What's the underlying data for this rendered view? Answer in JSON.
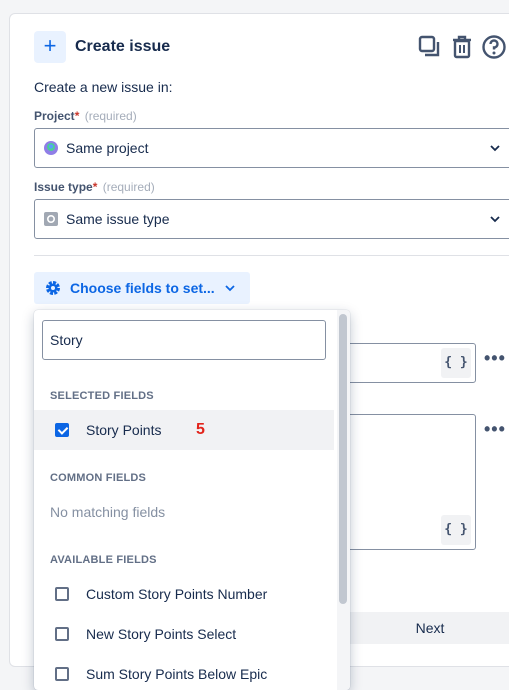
{
  "header": {
    "title": "Create issue",
    "plus_icon": "+"
  },
  "subtitle": "Create a new issue in:",
  "project": {
    "label": "Project",
    "required_mark": "*",
    "required_text": "(required)",
    "value": "Same project"
  },
  "issue_type": {
    "label": "Issue type",
    "required_mark": "*",
    "required_text": "(required)",
    "value": "Same issue type"
  },
  "choose_fields": {
    "label": "Choose fields to set..."
  },
  "dropdown": {
    "search_value": "Story",
    "selected_header": "SELECTED FIELDS",
    "selected_items": [
      {
        "label": "Story Points",
        "checked": true,
        "badge": "5"
      }
    ],
    "common_header": "COMMON FIELDS",
    "common_empty": "No matching fields",
    "available_header": "AVAILABLE FIELDS",
    "available_items": [
      {
        "label": "Custom Story Points Number",
        "checked": false
      },
      {
        "label": "New Story Points Select",
        "checked": false
      },
      {
        "label": "Sum Story Points Below Epic",
        "checked": false
      }
    ]
  },
  "background": {
    "braces_label": "{ }",
    "dots": "•••",
    "next_label": "Next"
  },
  "colors": {
    "accent": "#0c66e4",
    "badge": "#e2231a",
    "required": "#c9372c"
  }
}
